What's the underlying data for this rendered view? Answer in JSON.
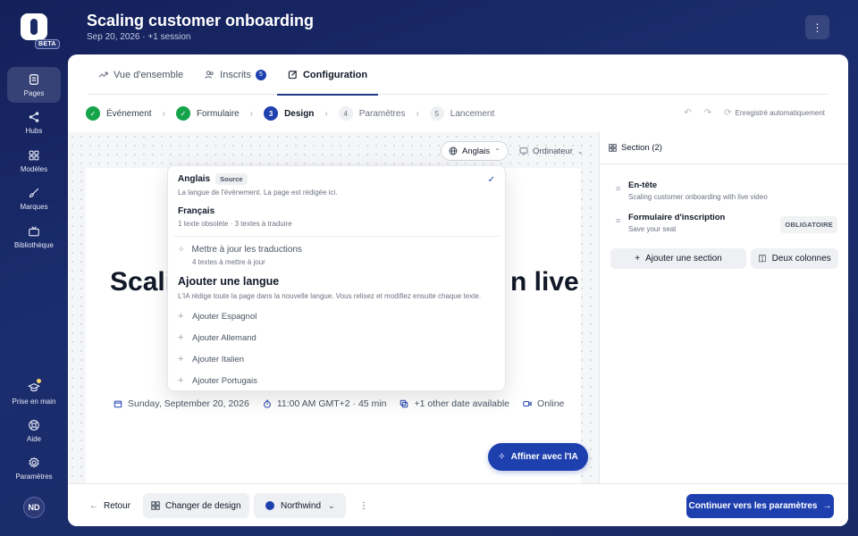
{
  "app": {
    "beta": "BETA",
    "avatar": "ND"
  },
  "sidebar": {
    "items": [
      {
        "label": "Pages",
        "icon": "pages-icon"
      },
      {
        "label": "Hubs",
        "icon": "share-icon"
      },
      {
        "label": "Modèles",
        "icon": "grid-icon"
      },
      {
        "label": "Marques",
        "icon": "brush-icon"
      },
      {
        "label": "Bibliothèque",
        "icon": "tv-icon"
      }
    ],
    "bottom": [
      {
        "label": "Prise en main",
        "icon": "cap-icon"
      },
      {
        "label": "Aide",
        "icon": "lifebuoy-icon"
      },
      {
        "label": "Paramètres",
        "icon": "gear-icon"
      }
    ]
  },
  "header": {
    "title": "Scaling customer onboarding",
    "subtitle": "Sep 20, 2026 · +1 session",
    "more": "⋮"
  },
  "tabs": [
    {
      "label": "Vue d'ensemble"
    },
    {
      "label": "Inscrits",
      "badge": "5"
    },
    {
      "label": "Configuration"
    }
  ],
  "steps": [
    {
      "num": "✓",
      "label": "Événement"
    },
    {
      "num": "✓",
      "label": "Formulaire"
    },
    {
      "num": "3",
      "label": "Design"
    },
    {
      "num": "4",
      "label": "Paramètres"
    },
    {
      "num": "5",
      "label": "Lancement"
    }
  ],
  "autosave": "Enregistré automatiquement",
  "canvas": {
    "language_chip": "Anglais",
    "device_chip": "Ordinateur",
    "title_left": "Scali",
    "title_right": "n live",
    "meta": {
      "date": "Sunday, September 20, 2026",
      "time": "11:00 AM GMT+2 · 45 min",
      "other": "+1 other date available",
      "location": "Online"
    },
    "ai_button": "Affiner avec l'IA"
  },
  "dropdown": {
    "current": {
      "title": "Anglais",
      "badge": "Source",
      "sub": "La langue de l'événement. La page est rédigée ici."
    },
    "other": {
      "title": "Français",
      "sub": "1 texte obsolète · 3 textes à traduire"
    },
    "update": {
      "title": "Mettre à jour les traductions",
      "sub": "4 textes à mettre à jour"
    },
    "add_heading": "Ajouter une langue",
    "add_sub": "L'IA rédige toute la page dans la nouvelle langue. Vous relisez et modifiez ensuite chaque texte.",
    "add_items": [
      "Ajouter Espagnol",
      "Ajouter Allemand",
      "Ajouter Italien",
      "Ajouter Portugais"
    ]
  },
  "right_panel": {
    "heading": "Section (2)",
    "sections": [
      {
        "title": "En-tête",
        "sub": "Scaling customer onboarding with live video"
      },
      {
        "title": "Formulaire d'inscription",
        "sub": "Save your seat",
        "badge": "OBLIGATOIRE"
      }
    ],
    "add_section": "Ajouter une section",
    "two_columns": "Deux colonnes"
  },
  "footer": {
    "back": "Retour",
    "change_design": "Changer de design",
    "theme": "Northwind",
    "continue": "Continuer vers les paramètres"
  },
  "colors": {
    "accent": "#1e40af",
    "success": "#16a34a",
    "background": "#1b2a66"
  }
}
